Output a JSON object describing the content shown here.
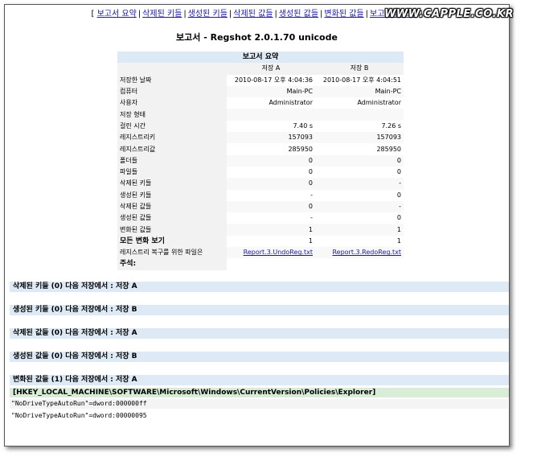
{
  "watermark": "WWW.CAPPLE.CO.KR",
  "nav": {
    "open": "[",
    "close": "]",
    "sep": "|",
    "links": [
      "보고서 요약",
      "삭제된 키들",
      "생성된 키들",
      "삭제된 값들",
      "생성된 값들",
      "변화된 값들",
      "보고서 끝으로"
    ]
  },
  "title": "보고서 - Regshot 2.0.1.70 unicode",
  "summary": {
    "heading": "보고서 요약",
    "col_a": "저장 A",
    "col_b": "저장 B",
    "rows": [
      {
        "label": "저장한 날짜",
        "a": "2010-08-17 오후 4:04:36",
        "b": "2010-08-17 오후 4:04:51"
      },
      {
        "label": "컴퓨터",
        "a": "Main-PC",
        "b": "Main-PC"
      },
      {
        "label": "사용자",
        "a": "Administrator",
        "b": "Administrator"
      },
      {
        "label": "저장 형태",
        "a": "",
        "b": ""
      },
      {
        "label": "걸린 시간",
        "a": "7.40 s",
        "b": "7.26 s"
      },
      {
        "label": "레지스트리키",
        "a": "157093",
        "b": "157093"
      },
      {
        "label": "레지스트리값",
        "a": "285950",
        "b": "285950"
      },
      {
        "label": "폴더들",
        "a": "0",
        "b": "0"
      },
      {
        "label": "파일들",
        "a": "0",
        "b": "0"
      },
      {
        "label": "삭제된 키들",
        "a": "0",
        "b": "-"
      },
      {
        "label": "생성된 키들",
        "a": "-",
        "b": "0"
      },
      {
        "label": "삭제된 값들",
        "a": "0",
        "b": "-"
      },
      {
        "label": "생성된 값들",
        "a": "-",
        "b": "0"
      },
      {
        "label": "변화된 값들",
        "a": "1",
        "b": "1"
      },
      {
        "label": "모든 변화 보기",
        "a": "1",
        "b": "1"
      }
    ],
    "undo_label": "레지스트리 복구를 위한 파일은",
    "undo_a": "Report.3.UndoReg.txt",
    "undo_b": "Report.3.RedoReg.txt",
    "notes_label": "주석:"
  },
  "sections": [
    "삭제된 키들 (0) 다음 저장에서 : 저장 A",
    "생성된 키들 (0) 다음 저장에서 : 저장 B",
    "삭제된 값들 (0) 다음 저장에서 : 저장 A",
    "생성된 값들 (0) 다음 저장에서 : 저장 B",
    "변화된 값들 (1) 다음 저장에서 : 저장 A"
  ],
  "changed": {
    "key": "[HKEY_LOCAL_MACHINE\\SOFTWARE\\Microsoft\\Windows\\CurrentVersion\\Policies\\Explorer]",
    "value_a": "\"NoDriveTypeAutoRun\"=dword:000000ff",
    "value_b": "\"NoDriveTypeAutoRun\"=dword:00000095"
  }
}
